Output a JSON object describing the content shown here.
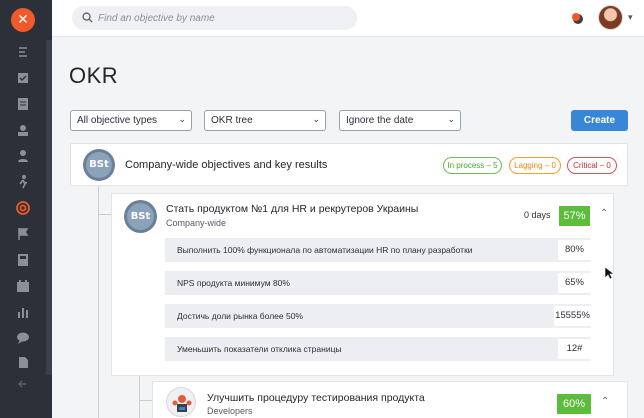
{
  "colors": {
    "brand": "#f05a2a",
    "sidebar": "#2c3038",
    "primary": "#3a86d6",
    "success": "#5cbc3c"
  },
  "sidebar": {
    "logo": "✕",
    "items": [
      {
        "icon": "dashboard-icon"
      },
      {
        "icon": "tasks-icon"
      },
      {
        "icon": "documents-icon"
      },
      {
        "icon": "team-icon"
      },
      {
        "icon": "profile-icon"
      },
      {
        "icon": "person-run-icon"
      },
      {
        "icon": "okr-target-icon",
        "active": true
      },
      {
        "icon": "flag-icon"
      },
      {
        "icon": "calculator-icon"
      },
      {
        "icon": "calendar-icon"
      },
      {
        "icon": "analytics-icon"
      },
      {
        "icon": "chat-icon"
      },
      {
        "icon": "knowledge-icon"
      },
      {
        "icon": "collapse-icon"
      }
    ]
  },
  "header": {
    "search_placeholder": "Find an objective by name",
    "notification_icon": "bell-icon",
    "avatar": "user-avatar"
  },
  "page": {
    "title": "OKR",
    "filters": [
      {
        "value": "All objective types"
      },
      {
        "value": "OKR tree"
      },
      {
        "value": "Ignore the date"
      }
    ],
    "create_label": "Create"
  },
  "company": {
    "logo_text": "BSt",
    "title": "Company-wide objectives and key results",
    "badges": {
      "in_process": "In process – 5",
      "lagging": "Lagging – 0",
      "critical": "Critical – 0"
    }
  },
  "objective": {
    "logo_text": "BSt",
    "title": "Стать продуктом №1 для HR и рекрутеров Украины",
    "owner": "Company-wide",
    "days": "0 days",
    "progress": "57%",
    "key_results": [
      {
        "label": "Выполнить 100% функционала по автоматизации HR по плану разработки",
        "value": "80%"
      },
      {
        "label": "NPS продукта минимум 80%",
        "value": "65%"
      },
      {
        "label": "Достичь доли рынка более 50%",
        "value": "15555%"
      },
      {
        "label": "Уменьшить показатели отклика страницы",
        "value": "12#"
      }
    ]
  },
  "objective2": {
    "title": "Улучшить процедуру тестирования продукта",
    "owner": "Developers",
    "progress": "60%"
  }
}
